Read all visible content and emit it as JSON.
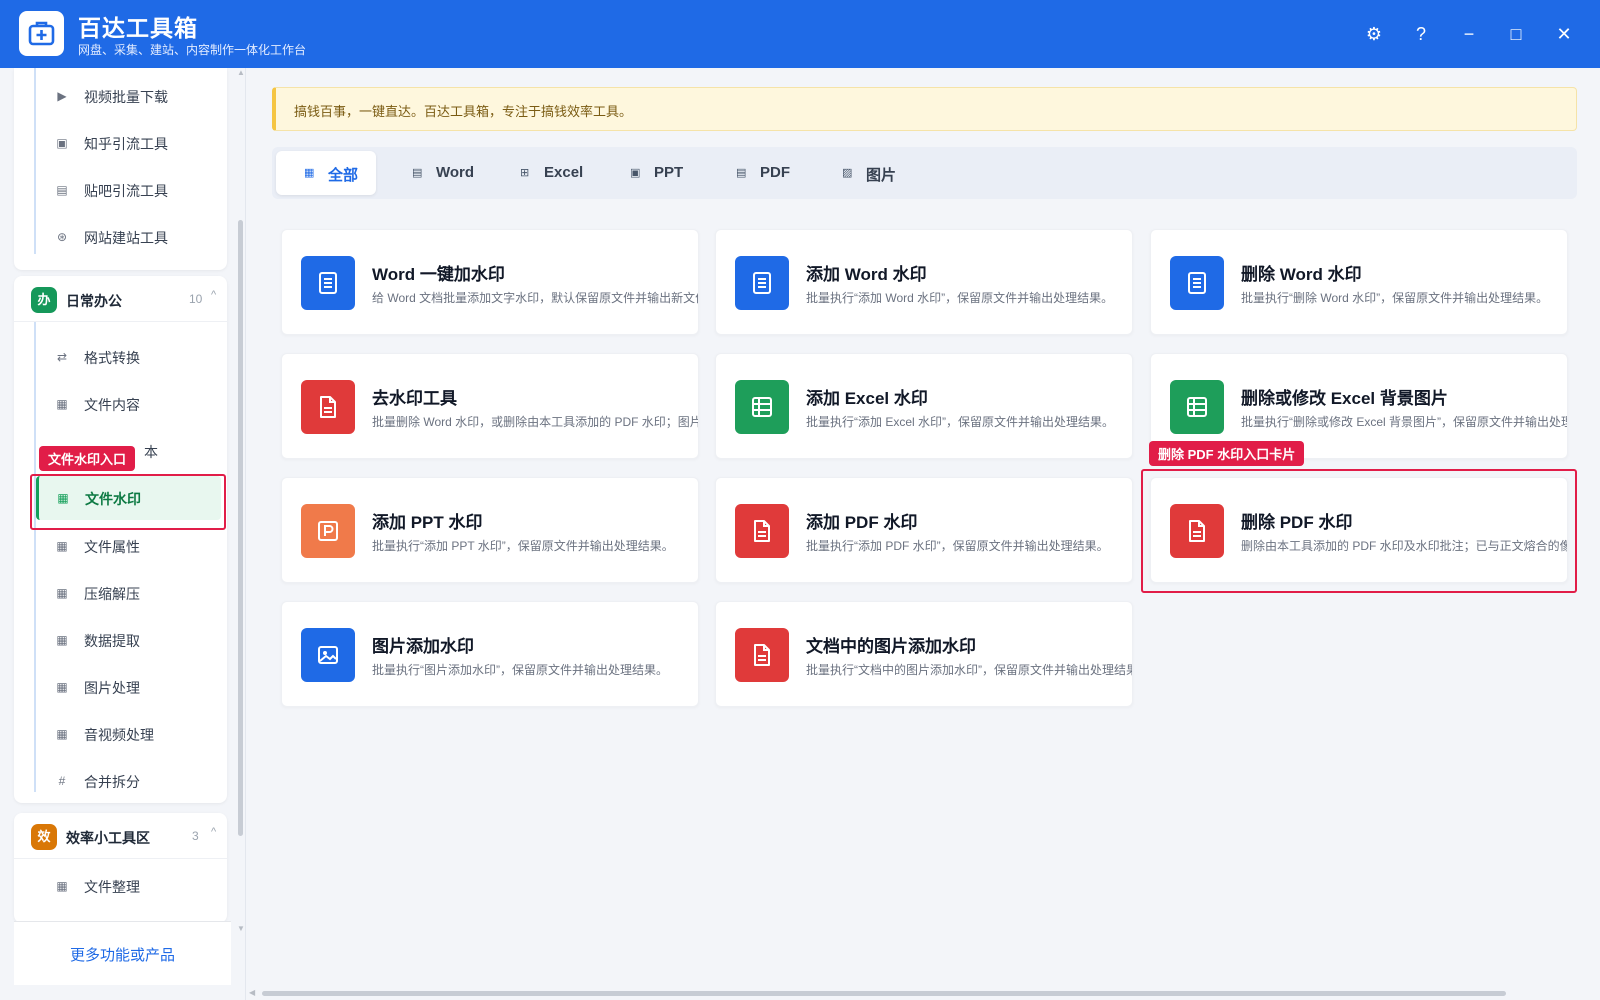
{
  "app": {
    "title": "百达工具箱",
    "subtitle": "网盘、采集、建站、内容制作一体化工作台"
  },
  "window_controls": {
    "settings": "⚙",
    "help": "?",
    "minimize": "−",
    "maximize": "□",
    "close": "✕"
  },
  "sidebar": {
    "top_items": [
      {
        "label": "视频批量下载",
        "icon": "video-icon"
      },
      {
        "label": "知乎引流工具",
        "icon": "zhihu-icon"
      },
      {
        "label": "贴吧引流工具",
        "icon": "tieba-icon"
      },
      {
        "label": "网站建站工具",
        "icon": "website-icon"
      }
    ],
    "groups": [
      {
        "badge": "办",
        "badge_color": "#15985a",
        "title": "日常办公",
        "count": "10",
        "caret": "^",
        "items": [
          {
            "label": "格式转换",
            "icon": "⇄"
          },
          {
            "label": "文件内容",
            "icon": "▦"
          },
          {
            "label": "文件水印",
            "icon": "▦"
          },
          {
            "label": "文件属性",
            "icon": "▦"
          },
          {
            "label": "压缩解压",
            "icon": "▦"
          },
          {
            "label": "数据提取",
            "icon": "▦"
          },
          {
            "label": "图片处理",
            "icon": "▦"
          },
          {
            "label": "音视频处理",
            "icon": "▦"
          },
          {
            "label": "合并拆分",
            "icon": "#"
          }
        ],
        "partial_label": "本"
      },
      {
        "badge": "效",
        "badge_color": "#d97706",
        "title": "效率小工具区",
        "count": "3",
        "caret": "^",
        "items": [
          {
            "label": "文件整理",
            "icon": "▦"
          }
        ]
      }
    ],
    "more_link": "更多功能或产品"
  },
  "annotations": {
    "sidebar_tag": "文件水印入口",
    "card_tag": "删除 PDF 水印入口卡片"
  },
  "notice": "搞钱百事，一键直达。百达工具箱，专注于搞钱效率工具。",
  "tabs": [
    {
      "label": "全部",
      "icon": "▦",
      "active": true
    },
    {
      "label": "Word",
      "icon": "▤",
      "active": false
    },
    {
      "label": "Excel",
      "icon": "⊞",
      "active": false
    },
    {
      "label": "PPT",
      "icon": "▣",
      "active": false
    },
    {
      "label": "PDF",
      "icon": "▤",
      "active": false
    },
    {
      "label": "图片",
      "icon": "▨",
      "active": false
    }
  ],
  "cards": [
    {
      "title": "Word 一键加水印",
      "desc": "给 Word 文档批量添加文字水印，默认保留原文件并输出新文件。",
      "icon": "word-doc-icon",
      "color": "#1f6ae6"
    },
    {
      "title": "添加 Word 水印",
      "desc": "批量执行“添加 Word 水印”，保留原文件并输出处理结果。",
      "icon": "word-doc-icon",
      "color": "#1f6ae6"
    },
    {
      "title": "删除 Word 水印",
      "desc": "批量执行“删除 Word 水印”，保留原文件并输出处理结果。",
      "icon": "word-doc-icon",
      "color": "#1f6ae6"
    },
    {
      "title": "去水印工具",
      "desc": "批量删除 Word 水印，或删除由本工具添加的 PDF 水印；图片/视频水印请到对应模块处理。",
      "icon": "pdf-file-icon",
      "color": "#e03a3a"
    },
    {
      "title": "添加 Excel 水印",
      "desc": "批量执行“添加 Excel 水印”，保留原文件并输出处理结果。",
      "icon": "excel-grid-icon",
      "color": "#1e9e5a"
    },
    {
      "title": "删除或修改 Excel 背景图片",
      "desc": "批量执行“删除或修改 Excel 背景图片”，保留原文件并输出处理结果。",
      "icon": "excel-grid-icon",
      "color": "#1e9e5a"
    },
    {
      "title": "添加 PPT 水印",
      "desc": "批量执行“添加 PPT 水印”，保留原文件并输出处理结果。",
      "icon": "ppt-icon",
      "color": "#f07a4a"
    },
    {
      "title": "添加 PDF 水印",
      "desc": "批量执行“添加 PDF 水印”，保留原文件并输出处理结果。",
      "icon": "pdf-file-icon",
      "color": "#e03a3a"
    },
    {
      "title": "删除 PDF 水印",
      "desc": "删除由本工具添加的 PDF 水印及水印批注；已与正文熔合的像素水印暂不支持。",
      "icon": "pdf-file-icon",
      "color": "#e03a3a"
    },
    {
      "title": "图片添加水印",
      "desc": "批量执行“图片添加水印”，保留原文件并输出处理结果。",
      "icon": "image-icon",
      "color": "#1f6ae6"
    },
    {
      "title": "文档中的图片添加水印",
      "desc": "批量执行“文档中的图片添加水印”，保留原文件并输出处理结果。",
      "icon": "pdf-file-icon",
      "color": "#e03a3a"
    }
  ]
}
